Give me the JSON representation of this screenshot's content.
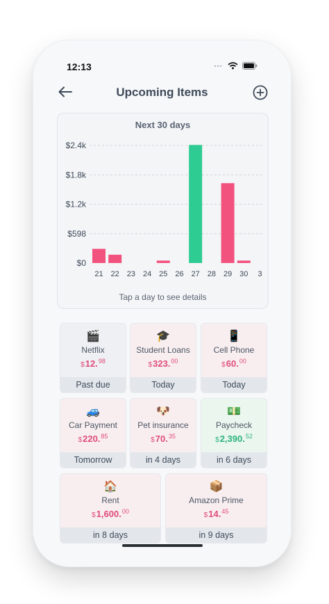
{
  "status": {
    "time": "12:13"
  },
  "header": {
    "title": "Upcoming Items",
    "back_icon": "arrow-left-icon",
    "add_icon": "plus-circle-icon"
  },
  "colors": {
    "bill": "#f2527e",
    "income": "#2ecc92",
    "income_text": "#2bb37c",
    "bill_text": "#e04c78"
  },
  "chart_data": {
    "type": "bar",
    "title": "Next 30 days",
    "hint": "Tap a day to see details",
    "categories": [
      "21",
      "22",
      "23",
      "24",
      "25",
      "26",
      "27",
      "28",
      "29",
      "30",
      "3"
    ],
    "values": [
      290,
      170,
      0,
      0,
      50,
      0,
      2410,
      0,
      1630,
      50,
      0
    ],
    "bar_kinds": [
      "bill",
      "bill",
      "none",
      "none",
      "bill",
      "none",
      "income",
      "none",
      "bill",
      "bill",
      "none"
    ],
    "y_ticks": [
      {
        "value": 0,
        "label": "$0"
      },
      {
        "value": 598,
        "label": "$598"
      },
      {
        "value": 1200,
        "label": "$1.2k"
      },
      {
        "value": 1800,
        "label": "$1.8k"
      },
      {
        "value": 2400,
        "label": "$2.4k"
      }
    ],
    "ylim": [
      0,
      2400
    ],
    "grid": true
  },
  "tiles": [
    {
      "emoji": "🎬",
      "icon": "clapper-icon",
      "name": "Netflix",
      "currency": "$",
      "amount": "12.",
      "cents": "98",
      "when": "Past due",
      "tone": "grey",
      "kind": "bill"
    },
    {
      "emoji": "🎓",
      "icon": "graduation-cap-icon",
      "name": "Student Loans",
      "currency": "$",
      "amount": "323.",
      "cents": "00",
      "when": "Today",
      "tone": "pink",
      "kind": "bill"
    },
    {
      "emoji": "📱",
      "icon": "phone-icon",
      "name": "Cell Phone",
      "currency": "$",
      "amount": "60.",
      "cents": "00",
      "when": "Today",
      "tone": "pink",
      "kind": "bill"
    },
    {
      "emoji": "🚙",
      "icon": "car-icon",
      "name": "Car Payment",
      "currency": "$",
      "amount": "220.",
      "cents": "85",
      "when": "Tomorrow",
      "tone": "pink",
      "kind": "bill"
    },
    {
      "emoji": "🐶",
      "icon": "dog-icon",
      "name": "Pet insurance",
      "currency": "$",
      "amount": "70.",
      "cents": "35",
      "when": "in 4 days",
      "tone": "pink",
      "kind": "bill"
    },
    {
      "emoji": "💵",
      "icon": "money-icon",
      "name": "Paycheck",
      "currency": "$",
      "amount": "2,390.",
      "cents": "52",
      "when": "in 6 days",
      "tone": "green",
      "kind": "income"
    },
    {
      "emoji": "🏠",
      "icon": "house-icon",
      "name": "Rent",
      "currency": "$",
      "amount": "1,600.",
      "cents": "00",
      "when": "in 8 days",
      "tone": "pink",
      "kind": "bill"
    },
    {
      "emoji": "📦",
      "icon": "package-icon",
      "name": "Amazon Prime",
      "currency": "$",
      "amount": "14.",
      "cents": "45",
      "when": "in 9 days",
      "tone": "pink",
      "kind": "bill"
    }
  ]
}
